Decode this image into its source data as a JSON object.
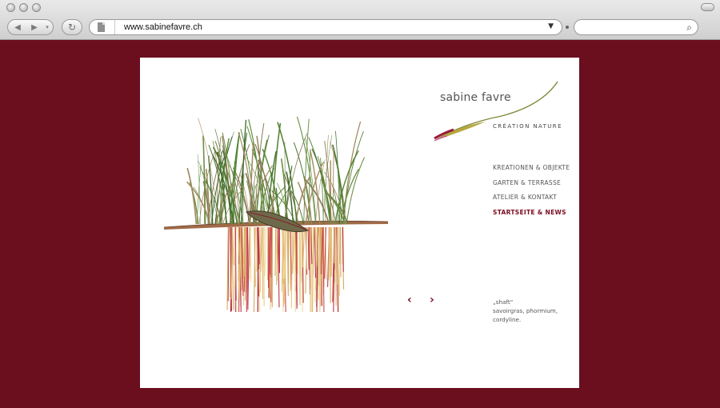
{
  "browser": {
    "url": "www.sabinefavre.ch",
    "icons": {
      "back": "back-arrow-icon",
      "forward": "forward-arrow-icon",
      "reload": "reload-icon",
      "page": "page-icon",
      "search": "magnifier-icon"
    }
  },
  "site": {
    "brand": "sabine favre",
    "tagline": "CRÉATION NATURE",
    "menu": [
      "KREATIONEN & OBJEKTE",
      "GARTEN & TERRASSE",
      "ATELIER & KONTAKT",
      "STARTSEITE & NEWS"
    ],
    "prev_label": "‹",
    "next_label": "›",
    "caption": {
      "title": "„shaft“",
      "line1": "savoirgras, phormium,",
      "line2": "cordyline."
    }
  },
  "colors": {
    "background": "#6b0f1f",
    "accent": "#7a0e20"
  }
}
